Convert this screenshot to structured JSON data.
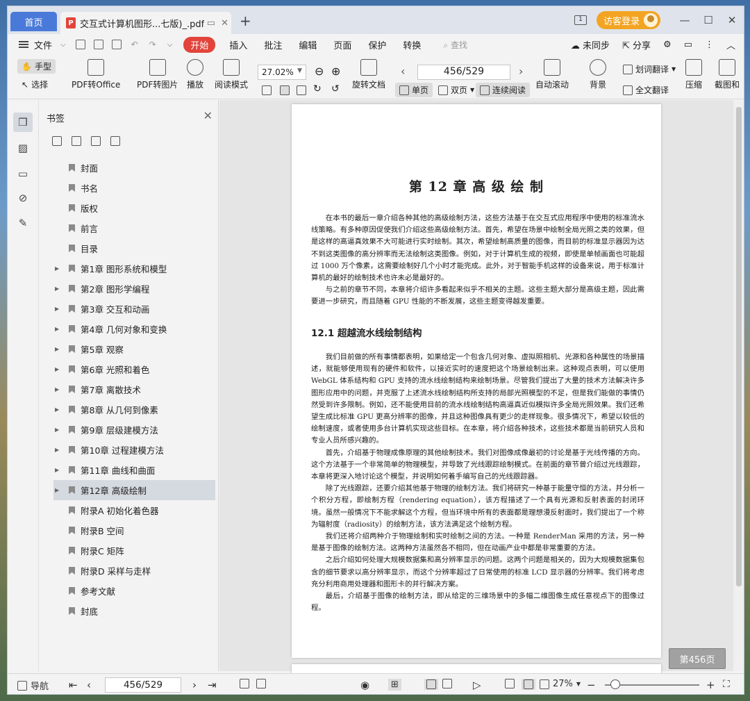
{
  "titlebar": {
    "home_tab": "首页",
    "doc_tab": "交互式计算机图形...七版)_.pdf",
    "pdf_badge": "P",
    "new_tab": "+",
    "page_count_icon": "1",
    "login_label": "访客登录"
  },
  "menu": {
    "file_label": "文件",
    "items": [
      "开始",
      "插入",
      "批注",
      "编辑",
      "页面",
      "保护",
      "转换"
    ],
    "search_placeholder": "查找",
    "sync_label": "未同步",
    "share_label": "分享"
  },
  "toolbar": {
    "hand_label": "手型",
    "select_label": "选择",
    "pdf_to_office": "PDF转Office",
    "pdf_to_image": "PDF转图片",
    "play_label": "播放",
    "read_mode": "阅读模式",
    "zoom_value": "27.02%",
    "rotate_doc": "旋转文档",
    "page_value": "456/529",
    "single_page": "单页",
    "double_page": "双页",
    "continuous": "连续阅读",
    "auto_scroll": "自动滚动",
    "background": "背景",
    "word_translate": "划词翻译",
    "full_translate": "全文翻译",
    "compress": "压缩",
    "screenshot": "截图和"
  },
  "bookmarks": {
    "title": "书签",
    "items": [
      {
        "label": "封面",
        "expandable": false
      },
      {
        "label": "书名",
        "expandable": false
      },
      {
        "label": "版权",
        "expandable": false
      },
      {
        "label": "前言",
        "expandable": false
      },
      {
        "label": "目录",
        "expandable": false
      },
      {
        "label": "第1章  图形系统和模型",
        "expandable": true
      },
      {
        "label": "第2章  图形学编程",
        "expandable": true
      },
      {
        "label": "第3章  交互和动画",
        "expandable": true
      },
      {
        "label": "第4章  几何对象和变换",
        "expandable": true
      },
      {
        "label": "第5章  观察",
        "expandable": true
      },
      {
        "label": "第6章  光照和着色",
        "expandable": true
      },
      {
        "label": "第7章  离散技术",
        "expandable": true
      },
      {
        "label": "第8章  从几何到像素",
        "expandable": true
      },
      {
        "label": "第9章  层级建模方法",
        "expandable": true
      },
      {
        "label": "第10章  过程建模方法",
        "expandable": true
      },
      {
        "label": "第11章  曲线和曲面",
        "expandable": true
      },
      {
        "label": "第12章  高级绘制",
        "expandable": true,
        "selected": true
      },
      {
        "label": "附录A  初始化着色器",
        "expandable": false
      },
      {
        "label": "附录B  空间",
        "expandable": false
      },
      {
        "label": "附录C  矩阵",
        "expandable": false
      },
      {
        "label": "附录D  采样与走样",
        "expandable": false
      },
      {
        "label": "参考文献",
        "expandable": false
      },
      {
        "label": "封底",
        "expandable": false
      }
    ]
  },
  "document": {
    "chapter_title": "第 12 章   高 级 绘 制",
    "intro_paragraphs": [
      "在本书的最后一章介绍各种其他的高级绘制方法，这些方法基于在交互式应用程序中使用的标准流水线策略。有多种原因促使我们介绍这些高级绘制方法。首先，希望在场景中绘制全局光照之类的效果，但是这样的高逼真效果不大可能进行实时绘制。其次，希望绘制高质量的图像，而目前的标准显示器因为达不到这类图像的高分辨率而无法绘制这类图像。例如，对于计算机生成的视频，即使是单帧画面也可能超过 1000 万个像素，这需要绘制好几个小时才能完成。此外，对于智能手机这样的设备来说，用于标准计算机的最好的绘制技术也许未必是最好的。",
      "与之前的章节不同，本章将介绍许多看起来似乎不相关的主题。这些主题大部分是高级主题，因此需要进一步研究，而且随着 GPU 性能的不断发展，这些主题变得越发重要。"
    ],
    "section_title": "12.1   超越流水线绘制结构",
    "section_paragraphs": [
      "我们目前做的所有事情都表明，如果给定一个包含几何对象、虚拟照相机、光源和各种属性的场景描述，就能够使用现有的硬件和软件，以接近实时的速度把这个场景绘制出来。这种观点表明，可以使用 WebGL 体系结构和 GPU 支持的流水线绘制结构来绘制场景。尽管我们提出了大量的技术方法解决许多图形应用中的问题，并克服了上述流水线绘制结构所支持的局部光照模型的不足，但是我们能做的事情仍然受到许多限制。例如，还不能使用目前的流水线绘制结构高逼真近似模拟许多全局光照效果。我们还希望生成比标准 GPU 更高分辨率的图像，并且这种图像具有更少的走样现象。很多情况下，希望以较低的绘制速度，或者使用多台计算机实现这些目标。在本章，将介绍各种技术，这些技术都是当前研究人员和专业人员所感兴趣的。",
      "首先，介绍基于物理成像原理的其他绘制技术。我们对图像成像最初的讨论是基于光线传播的方向。这个方法基于一个非常简单的物理模型，并导致了光线跟踪绘制模式。在前面的章节曾介绍过光线跟踪，本章将更深入地讨论这个模型，并说明如何着手编写自己的光线跟踪器。",
      "除了光线跟踪，还要介绍其他基于物理的绘制方法。我们将研究一种基于能量守恒的方法，并分析一个积分方程，即绘制方程（rendering equation），该方程描述了一个具有光源和反射表面的封闭环境。虽然一般情况下不能求解这个方程，但当环境中所有的表面都是理想漫反射面时，我们提出了一个称为辐射度（radiosity）的绘制方法，该方法满足这个绘制方程。",
      "我们还将介绍两种介于物理绘制和实时绘制之间的方法。一种是 RenderMan 采用的方法，另一种是基于图像的绘制方法。这两种方法虽然各不相同，但在动画产业中都是非常重要的方法。",
      "之后介绍如何处理大规模数据集和高分辨率显示的问题。这两个问题是相关的，因为大规模数据集包含的细节要求以高分辨率显示，而这个分辨率超过了日常使用的标准 LCD 显示器的分辨率。我们将考虑充分利用商用处理器和图形卡的并行解决方案。",
      "最后，介绍基于图像的绘制方法，即从给定的三维场景中的多幅二维图像生成任意视点下的图像过程。"
    ]
  },
  "page_badge": "第456页",
  "statusbar": {
    "nav_label": "导航",
    "page_value": "456/529",
    "zoom_value": "27%",
    "zoom_level": 0.27
  }
}
